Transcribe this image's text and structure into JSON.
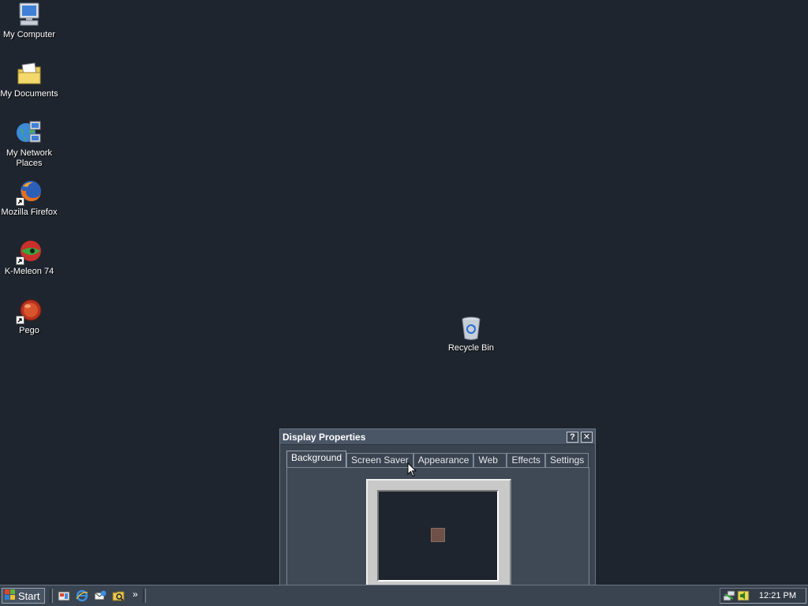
{
  "desktop": {
    "icons": [
      {
        "label": "My Computer",
        "icon": "computer-icon"
      },
      {
        "label": "My Documents",
        "icon": "folder-documents-icon"
      },
      {
        "label": "My Network Places",
        "icon": "network-icon"
      },
      {
        "label": "Mozilla Firefox",
        "icon": "firefox-icon"
      },
      {
        "label": "K-Meleon 74",
        "icon": "kmeleon-icon"
      },
      {
        "label": "Pego",
        "icon": "pego-icon"
      },
      {
        "label": "Recycle Bin",
        "icon": "recycle-bin-icon"
      }
    ]
  },
  "dialog": {
    "title": "Display Properties",
    "help_label": "?",
    "close_label": "✕",
    "tabs": [
      {
        "label": "Background",
        "active": true
      },
      {
        "label": "Screen Saver"
      },
      {
        "label": "Appearance"
      },
      {
        "label": "Web"
      },
      {
        "label": "Effects"
      },
      {
        "label": "Settings"
      }
    ]
  },
  "taskbar": {
    "start_label": "Start",
    "chevron": "»",
    "clock": "12:21 PM"
  },
  "colors": {
    "desktop_bg": "#1f252e",
    "window_bg": "#3a4350"
  }
}
